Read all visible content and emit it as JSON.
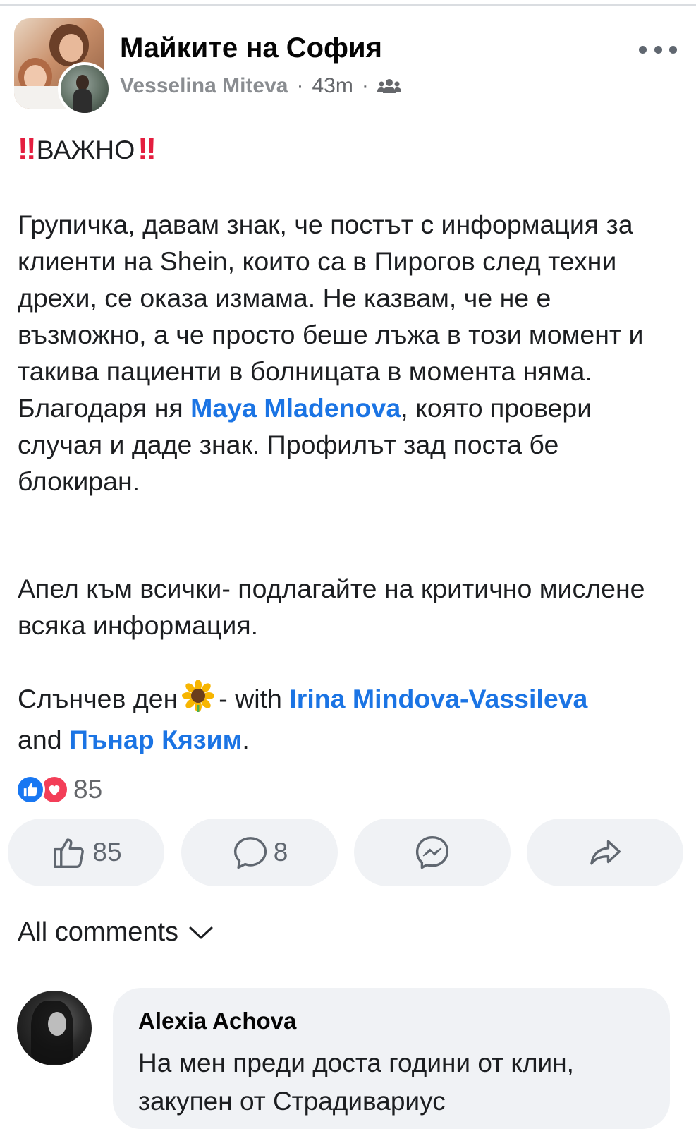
{
  "post": {
    "group_name": "Майките на София",
    "author": "Vesselina Miteva",
    "time": "43m",
    "separator": "·",
    "important_icon": "‼",
    "important_label": "ВАЖНО",
    "paragraph1_text_a": "Групичка, давам знак, че постът с информация за клиенти на Shein, които са в Пирогов след техни дрехи, се оказа измама. Не казвам, че не е възможно, а че просто беше лъжа в този момент и такива пациенти в болницата в момента няма. Благодаря ня ",
    "mention_1": "Maya Mladenova",
    "paragraph1_text_b": ", която провери случая и даде знак. Профилът зад поста бе блокиран.",
    "paragraph2": "Апел към всички- подлагайте на критично мислене всяка информация.",
    "closing_text": "Слънчев ден",
    "closing_with": "- with",
    "mention_2": "Irina Mindova-Vassileva",
    "closing_and": "and",
    "mention_3": "Пънар Кязим",
    "closing_period": "."
  },
  "reactions": {
    "count": "85",
    "types": [
      "like",
      "love"
    ]
  },
  "actions": {
    "like_count": "85",
    "comment_count": "8"
  },
  "comments": {
    "filter_label": "All comments",
    "items": [
      {
        "author": "Alexia Achova",
        "text": "На мен преди доста години от клин, закупен от Страдивариус"
      }
    ]
  },
  "colors": {
    "mention": "#1b74e4",
    "important": "#e41e3f",
    "button_bg": "#f0f2f5",
    "icon_gray": "#606770"
  },
  "icons": [
    "more-icon",
    "members-icon",
    "sunflower-icon",
    "like-reaction-icon",
    "love-reaction-icon",
    "thumbs-up-icon",
    "comment-icon",
    "messenger-icon",
    "share-icon",
    "chevron-down-icon"
  ]
}
